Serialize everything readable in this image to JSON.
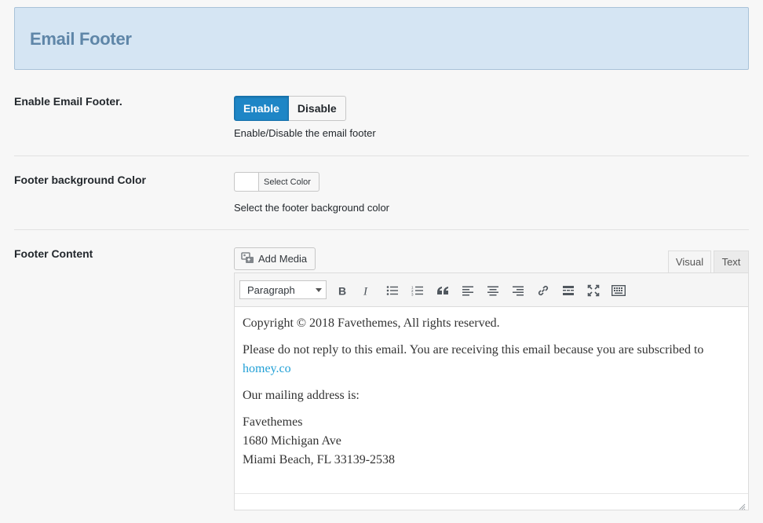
{
  "section": {
    "title": "Email Footer"
  },
  "enable_row": {
    "label": "Enable Email Footer.",
    "enable_label": "Enable",
    "disable_label": "Disable",
    "selected": "Enable",
    "help": "Enable/Disable the email footer"
  },
  "color_row": {
    "label": "Footer background Color",
    "button_label": "Select Color",
    "current_color": "#ffffff",
    "help": "Select the footer background color"
  },
  "content_row": {
    "label": "Footer Content",
    "add_media_label": "Add Media",
    "tabs": {
      "visual": "Visual",
      "text": "Text",
      "active": "Visual"
    },
    "format_select": "Paragraph",
    "toolbar_icons": [
      "bold-icon",
      "italic-icon",
      "bullet-list-icon",
      "numbered-list-icon",
      "blockquote-icon",
      "align-left-icon",
      "align-center-icon",
      "align-right-icon",
      "link-icon",
      "read-more-icon",
      "fullscreen-icon",
      "toolbar-toggle-icon"
    ],
    "body": {
      "line1": "Copyright © 2018 Favethemes, All rights reserved.",
      "line2_text": "Please do not reply to this email. You are receiving this email because you are subscribed to",
      "line2_link": "homey.co",
      "line3": "Our mailing address is:",
      "address": [
        "Favethemes",
        "1680 Michigan Ave",
        "Miami Beach, FL 33139-2538"
      ]
    }
  },
  "colors": {
    "accent": "#1e86c6",
    "header_bg": "#d5e5f3",
    "header_text": "#5f86a8",
    "link": "#21a0d6"
  }
}
